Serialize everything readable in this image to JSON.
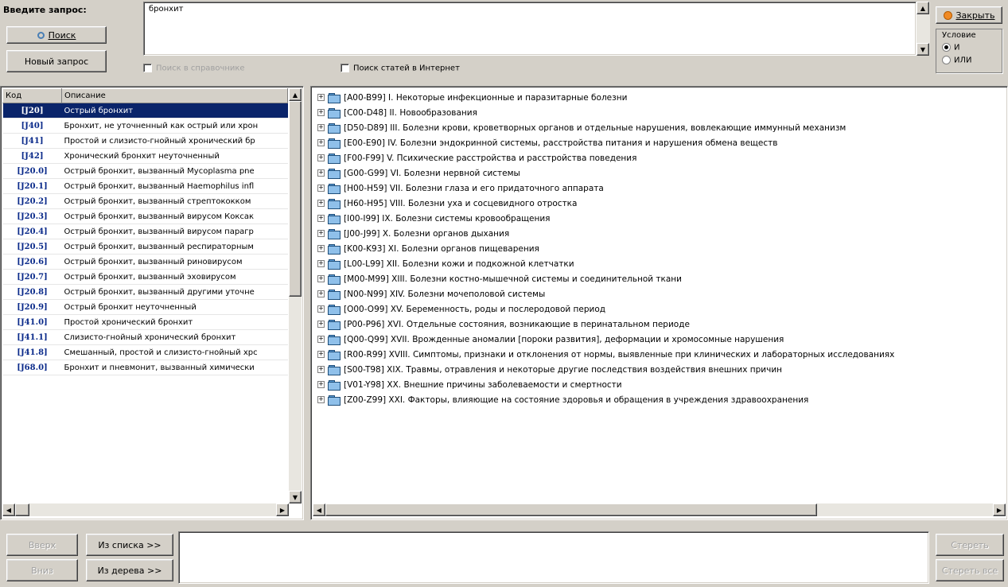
{
  "query": {
    "label": "Введите запрос:",
    "value": "бронхит",
    "search_button": "Поиск",
    "new_query_button": "Новый запрос",
    "search_reference_checkbox": "Поиск в справочнике",
    "search_internet_checkbox": "Поиск статей в Интернет"
  },
  "top_right": {
    "close_button": "Закрыть",
    "condition_label": "Условие",
    "radio_and": "И",
    "radio_or": "ИЛИ"
  },
  "list": {
    "columns": [
      "Код",
      "Описание"
    ],
    "rows": [
      {
        "code": "[J20]",
        "desc": "Острый бронхит"
      },
      {
        "code": "[J40]",
        "desc": "Бронхит, не уточненный как острый или хрон"
      },
      {
        "code": "[J41]",
        "desc": "Простой и слизисто-гнойный хронический бр"
      },
      {
        "code": "[J42]",
        "desc": "Хронический бронхит неуточненный"
      },
      {
        "code": "[J20.0]",
        "desc": "Острый бронхит, вызванный Mycoplasma pne"
      },
      {
        "code": "[J20.1]",
        "desc": "Острый бронхит, вызванный Haemophilus infl"
      },
      {
        "code": "[J20.2]",
        "desc": "Острый бронхит, вызванный стрептококком"
      },
      {
        "code": "[J20.3]",
        "desc": "Острый бронхит, вызванный вирусом Коксак"
      },
      {
        "code": "[J20.4]",
        "desc": "Острый бронхит, вызванный вирусом парагр"
      },
      {
        "code": "[J20.5]",
        "desc": "Острый бронхит, вызванный респираторным"
      },
      {
        "code": "[J20.6]",
        "desc": "Острый бронхит, вызванный риновирусом"
      },
      {
        "code": "[J20.7]",
        "desc": "Острый бронхит, вызванный эховирусом"
      },
      {
        "code": "[J20.8]",
        "desc": "Острый бронхит, вызванный другими уточне"
      },
      {
        "code": "[J20.9]",
        "desc": "Острый бронхит неуточненный"
      },
      {
        "code": "[J41.0]",
        "desc": "Простой хронический бронхит"
      },
      {
        "code": "[J41.1]",
        "desc": "Слизисто-гнойный хронический бронхит"
      },
      {
        "code": "[J41.8]",
        "desc": "Смешанный, простой и слизисто-гнойный хрс"
      },
      {
        "code": "[J68.0]",
        "desc": "Бронхит и пневмонит, вызванный химически"
      }
    ]
  },
  "tree": [
    "[A00-B99] I. Некоторые инфекционные и паразитарные болезни",
    "[C00-D48] II. Новообразования",
    "[D50-D89] III. Болезни крови, кроветворных органов и отдельные нарушения, вовлекающие иммунный механизм",
    "[E00-E90] IV. Болезни эндокринной системы, расстройства питания и нарушения обмена веществ",
    "[F00-F99] V. Психические расстройства и расстройства поведения",
    "[G00-G99] VI. Болезни нервной системы",
    "[H00-H59] VII. Болезни глаза и его придаточного аппарата",
    "[H60-H95] VIII. Болезни уха и сосцевидного отростка",
    "[I00-I99] IX. Болезни системы кровообращения",
    "[J00-J99] X. Болезни органов дыхания",
    "[K00-K93] XI. Болезни органов пищеварения",
    "[L00-L99] XII. Болезни кожи и подкожной клетчатки",
    "[M00-M99] XIII. Болезни костно-мышечной системы и соединительной ткани",
    "[N00-N99] XIV. Болезни мочеполовой системы",
    "[O00-O99] XV. Беременность, роды и послеродовой период",
    "[P00-P96] XVI. Отдельные состояния, возникающие в перинатальном периоде",
    "[Q00-Q99] XVII. Врожденные аномалии [пороки развития], деформации и хромосомные нарушения",
    "[R00-R99] XVIII. Симптомы, признаки и отклонения от нормы, выявленные при клинических и лабораторных исследованиях",
    "[S00-T98] XIX. Травмы, отравления и некоторые другие последствия воздействия внешних причин",
    "[V01-Y98] XX. Внешние причины заболеваемости и смертности",
    "[Z00-Z99] XXI. Факторы, влияющие на состояние здоровья и обращения в учреждения здравоохранения"
  ],
  "bottom": {
    "up_button": "Вверх",
    "down_button": "Вниз",
    "from_list_button": "Из списка >>",
    "from_tree_button": "Из дерева >>",
    "clear_button": "Стереть",
    "clear_all_button": "Стереть все"
  }
}
